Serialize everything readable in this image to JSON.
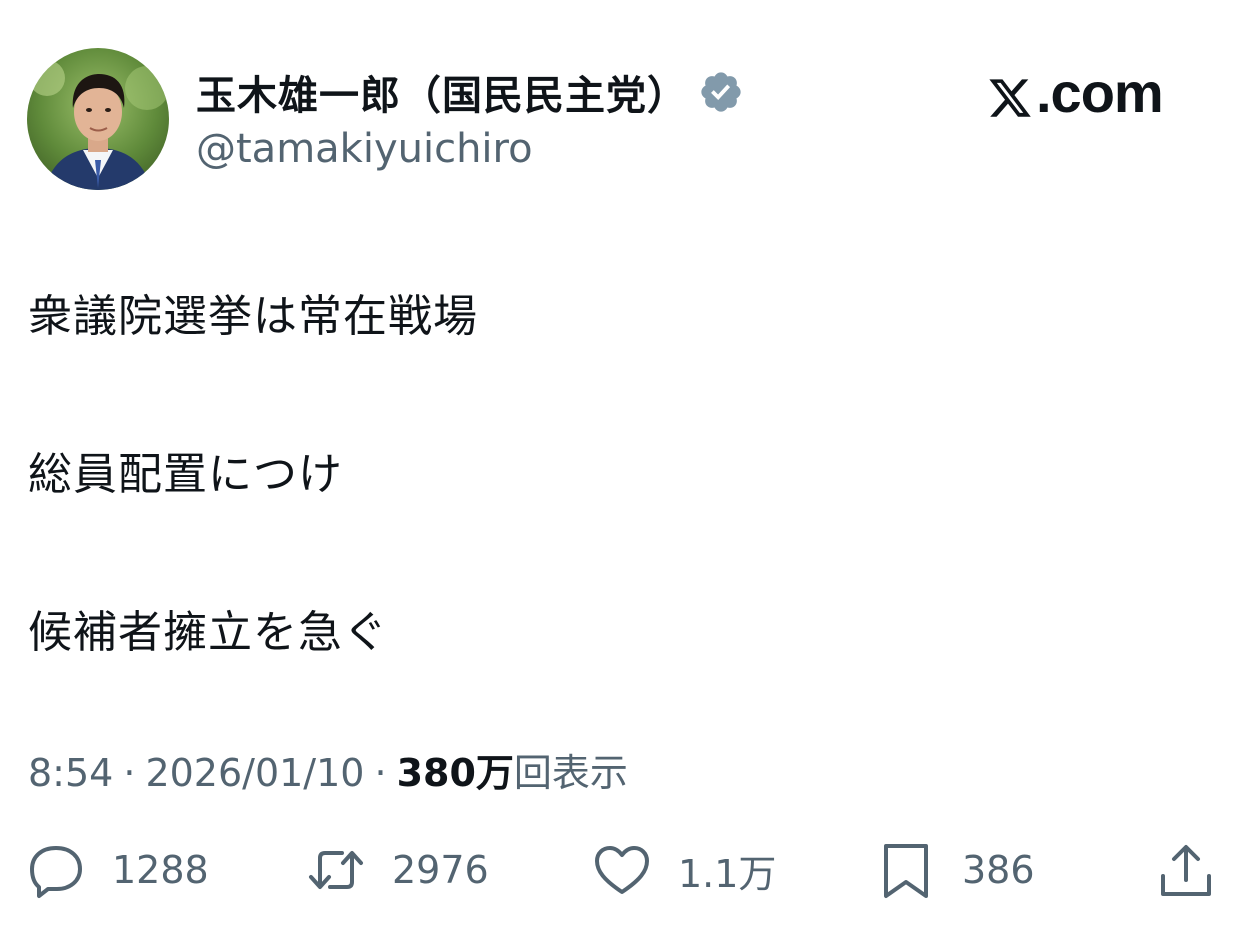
{
  "author": {
    "display_name": "玉木雄一郎（国民民主党）",
    "handle": "@tamakiyuichiro",
    "verified_color": "#829aab"
  },
  "brand": {
    "site": ".com",
    "logo_icon": "x-logo-icon"
  },
  "tweet": {
    "lines": [
      "衆議院選挙は常在戦場",
      "総員配置につけ",
      "候補者擁立を急ぐ"
    ]
  },
  "meta": {
    "time": "8:54",
    "separator": "·",
    "date": "2026/01/10",
    "views_count": "380万",
    "views_label": "回表示"
  },
  "actions": {
    "reply": {
      "icon": "reply-icon",
      "count": "1288"
    },
    "retweet": {
      "icon": "retweet-icon",
      "count": "2976"
    },
    "like": {
      "icon": "heart-icon",
      "count": "1.1万"
    },
    "bookmark": {
      "icon": "bookmark-icon",
      "count": "386"
    },
    "share": {
      "icon": "share-icon"
    }
  }
}
